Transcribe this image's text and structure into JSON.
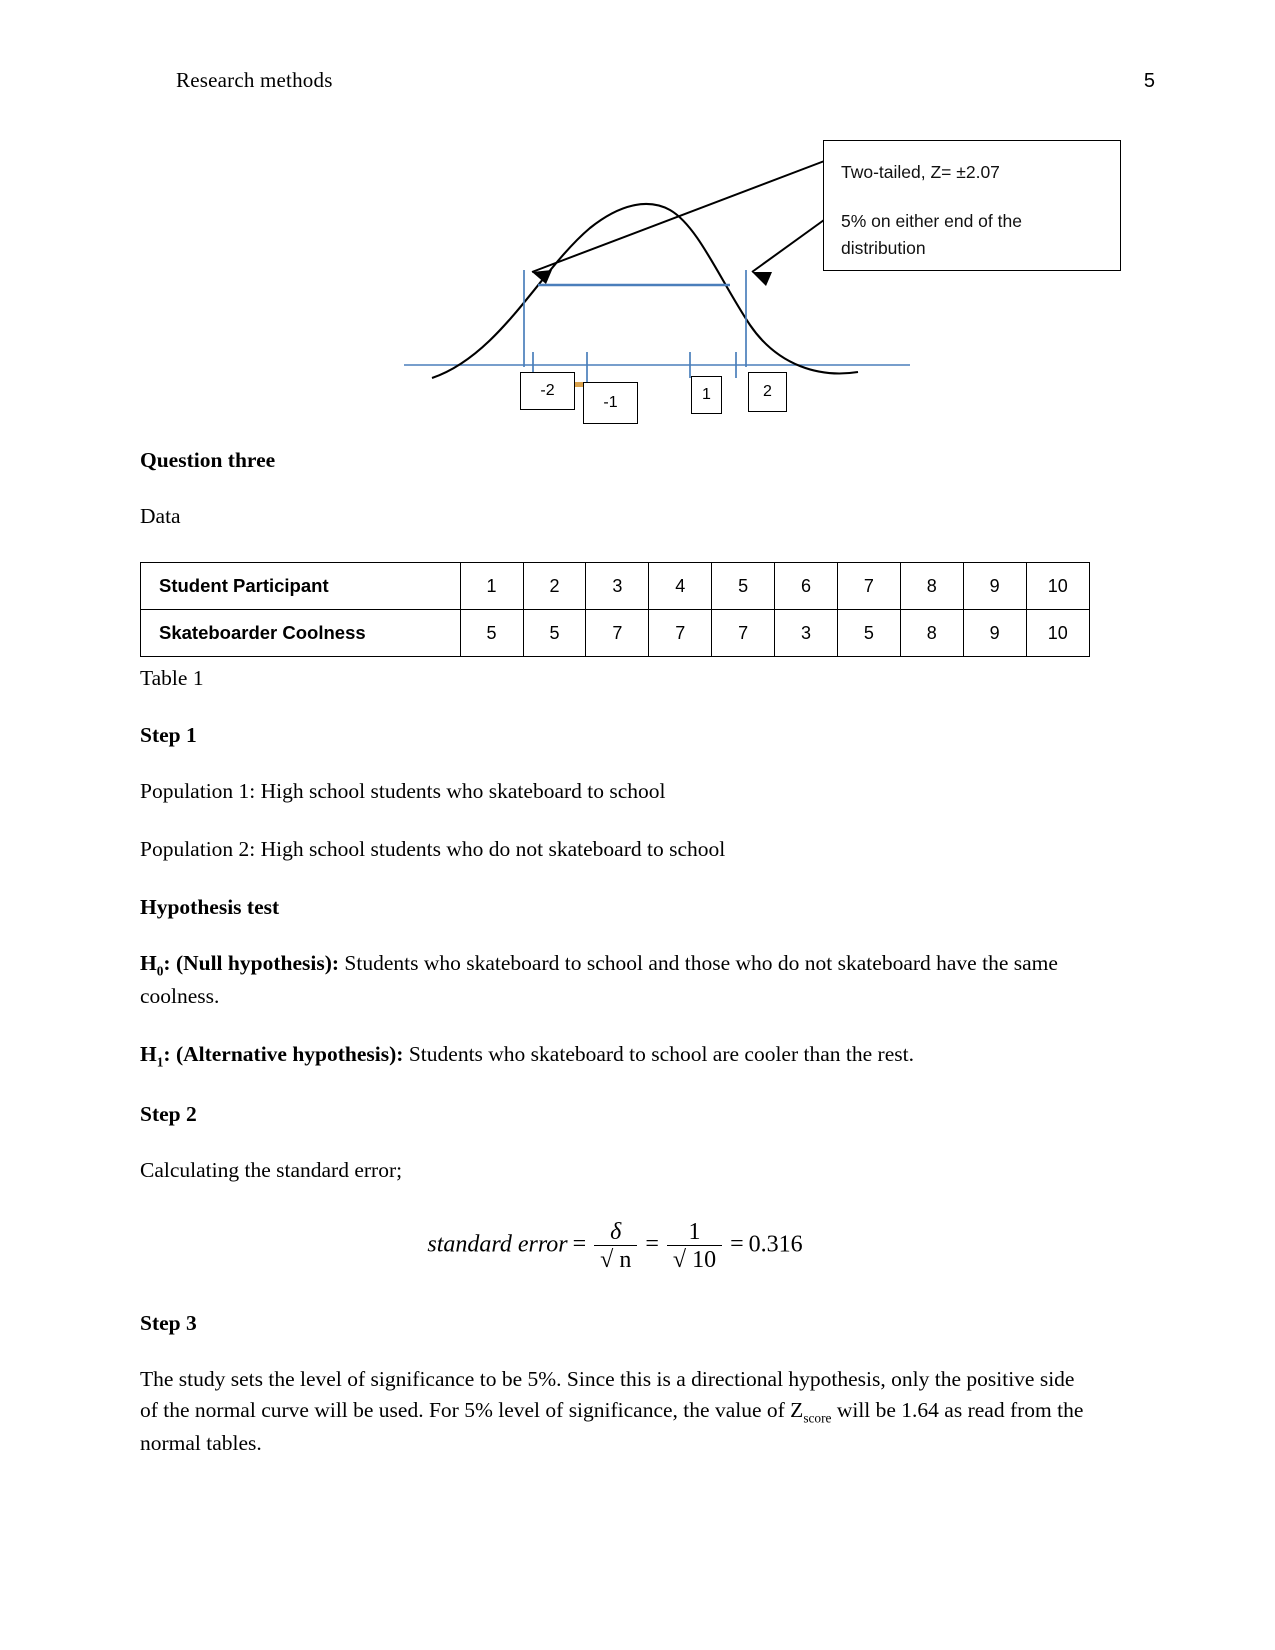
{
  "header": {
    "title": "Research methods",
    "page_number": "5"
  },
  "figure": {
    "callout": {
      "line1": "Two-tailed, Z= ±2.07",
      "line2": "5% on either end of the",
      "line3": "distribution"
    },
    "axis_tick_labels": [
      "-2",
      "-1",
      "1",
      "2"
    ],
    "colors": {
      "curve": "#000000",
      "axis": "#4a7ebb",
      "marker": "#4a7ebb",
      "highlight": "#d9a14b"
    }
  },
  "sections": {
    "question_heading": "Question three",
    "data_label": "Data",
    "table_caption": "Table 1",
    "step1_heading": "Step 1",
    "population1": "Population 1: High school students who skateboard to school",
    "population2": "Population 2: High school students who do not skateboard to school",
    "hypothesis_heading": "Hypothesis test",
    "null_label_pre": "H",
    "null_label_sub": "0",
    "null_label_post": ": (Null hypothesis):",
    "null_text": " Students who skateboard to school and those who do not skateboard have the same coolness.",
    "alt_label_pre": "H",
    "alt_label_sub": "1",
    "alt_label_post": ": (Alternative hypothesis):",
    "alt_text": " Students who skateboard to school are cooler than the rest.",
    "step2_heading": "Step 2",
    "step2_text": "Calculating the standard error;",
    "step3_heading": "Step 3",
    "step3_text_part1": "The study sets the level of significance to be 5%. Since this is a directional hypothesis, only the positive side of the normal curve will be used. For 5% level of significance, the value of Z",
    "step3_sub": "score",
    "step3_text_part2": " will be 1.64 as read from the normal tables."
  },
  "formula": {
    "lhs": "standard error",
    "eq1": "=",
    "num1": "δ",
    "den1": "√ n",
    "eq2": "=",
    "num2": "1",
    "den2": "√ 10",
    "eq3": "=",
    "result": "0.316"
  },
  "table": {
    "rows": [
      {
        "label": "Student Participant",
        "values": [
          "1",
          "2",
          "3",
          "4",
          "5",
          "6",
          "7",
          "8",
          "9",
          "10"
        ]
      },
      {
        "label": "Skateboarder Coolness",
        "values": [
          "5",
          "5",
          "7",
          "7",
          "7",
          "3",
          "5",
          "8",
          "9",
          "10"
        ]
      }
    ]
  },
  "chart_data": {
    "type": "line",
    "title": "",
    "xlabel": "",
    "ylabel": "",
    "x_ticks": [
      -2,
      -1,
      1,
      2
    ],
    "x_tick_labels": [
      "-2",
      "-1",
      "1",
      "2"
    ],
    "annotations": [
      "Two-tailed, Z= ±2.07",
      "5% on either end of the distribution"
    ],
    "critical_values": [
      -2.07,
      2.07
    ],
    "alpha_each_tail": 0.05
  }
}
